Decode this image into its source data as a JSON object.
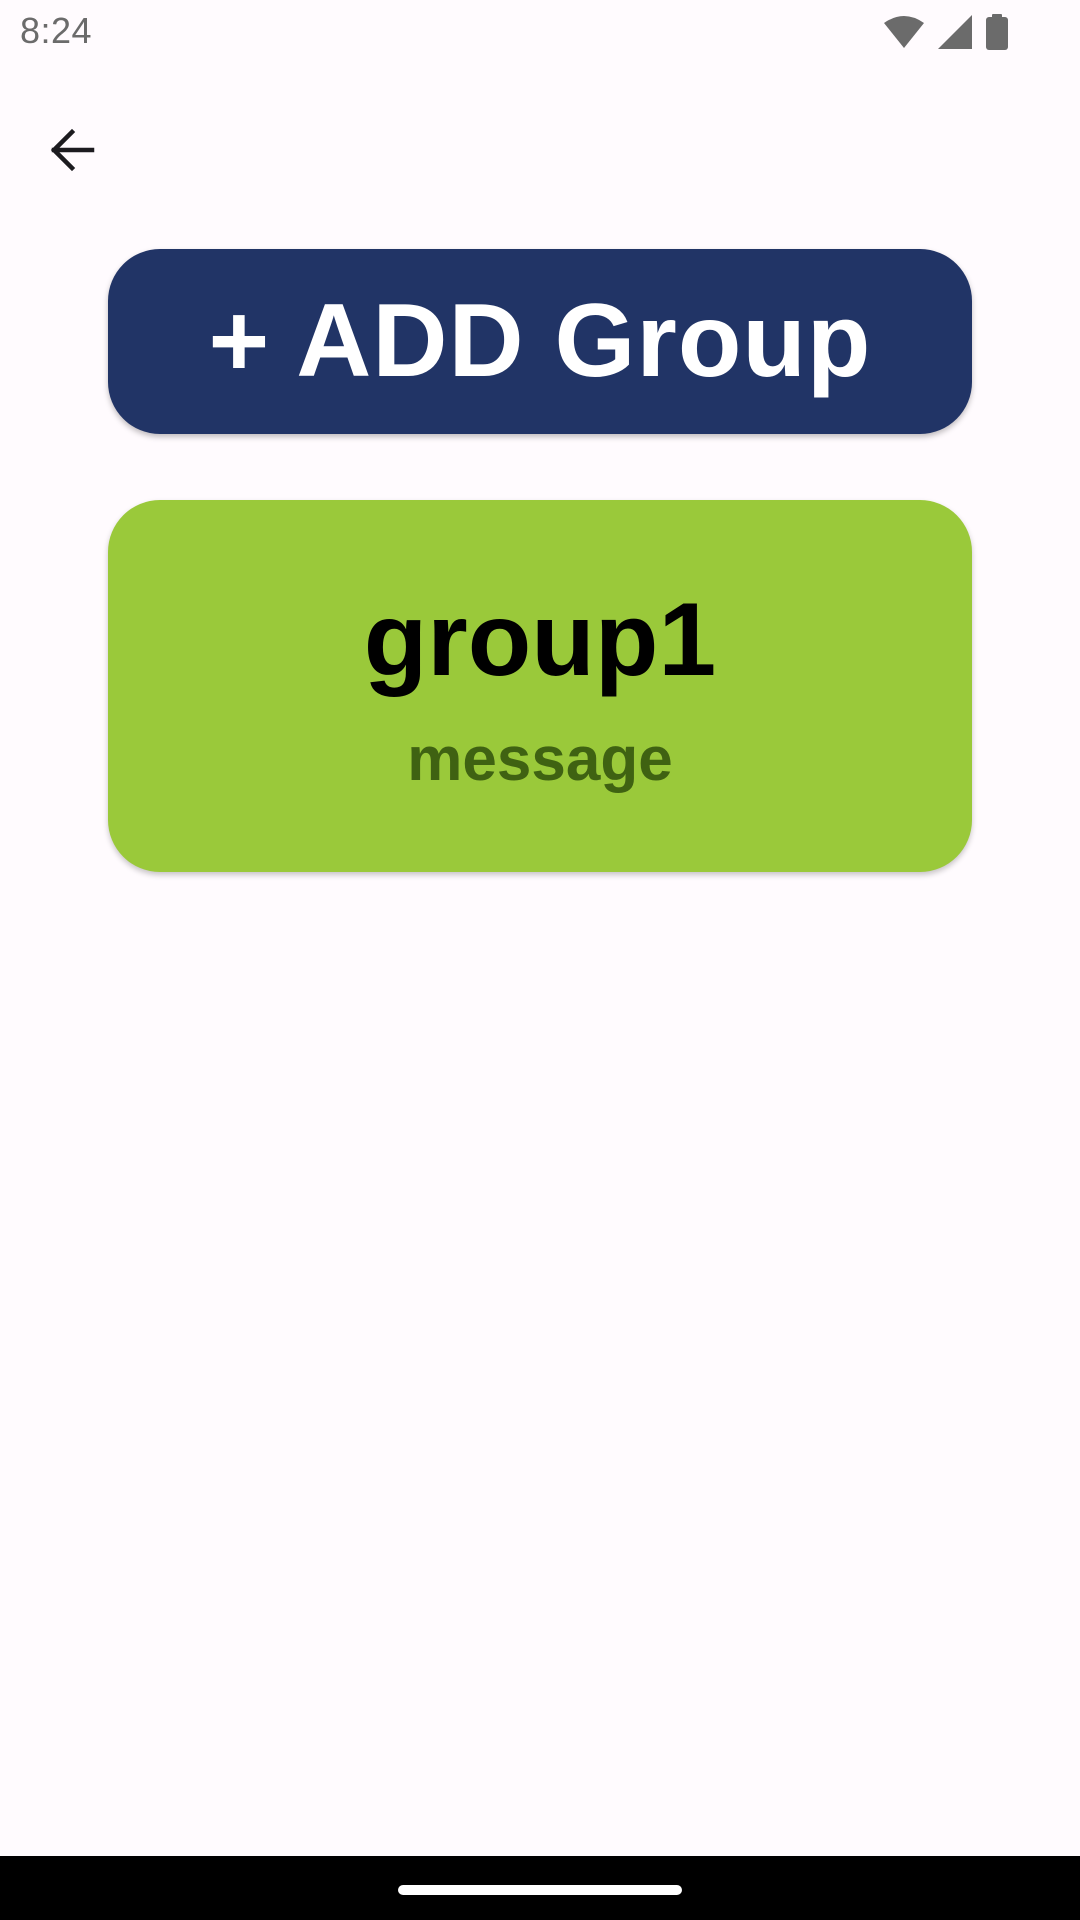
{
  "status_bar": {
    "time": "8:24",
    "icons": [
      "wifi-icon",
      "signal-icon",
      "battery-icon"
    ],
    "icon_color": "#6b6b6b"
  },
  "app_bar": {
    "back_icon": "arrow-back-icon"
  },
  "add_group_button": {
    "label": "+ ADD Group",
    "background": "#213466",
    "text_color": "#ffffff"
  },
  "groups": [
    {
      "name": "group1",
      "message": "message",
      "background": "#9ac93a",
      "message_color": "#3f6212"
    }
  ],
  "theme": {
    "page_background": "#fffbfe",
    "nav_bar_background": "#000000"
  }
}
